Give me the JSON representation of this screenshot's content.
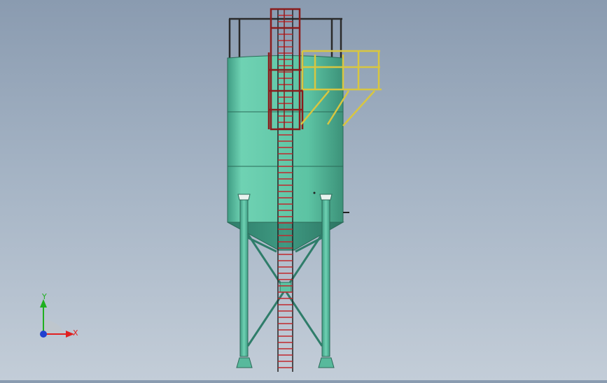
{
  "model": {
    "name": "",
    "colors": {
      "silo_body": "#5fc8a8",
      "silo_shadow": "#3e9c82",
      "ladder_red": "#8a1c1c",
      "platform_yellow": "#e2d24a",
      "railing_dark": "#2a2a2a"
    }
  },
  "triad": {
    "x_label": "X",
    "y_label": "Y",
    "colors": {
      "x": "#e02020",
      "y": "#20b020",
      "z": "#2040d0"
    }
  }
}
